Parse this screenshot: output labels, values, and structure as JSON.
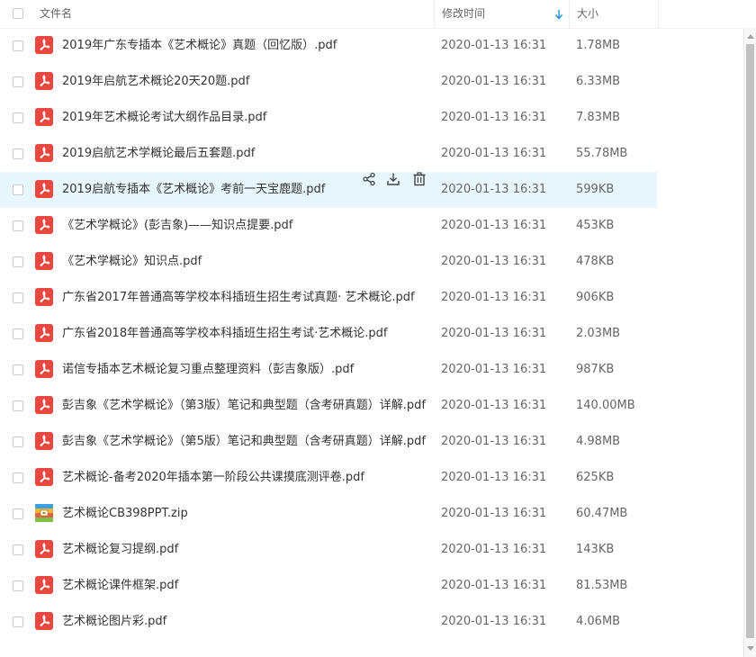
{
  "header": {
    "name_label": "文件名",
    "time_label": "修改时间",
    "size_label": "大小"
  },
  "colors": {
    "pdf_icon": "#e8483d",
    "highlight_row": "#e8f6fd",
    "sort_arrow": "#1e90e8"
  },
  "files": [
    {
      "name": "2019年广东专插本《艺术概论》真题（回忆版）.pdf",
      "time": "2020-01-13 16:31",
      "size": "1.78MB",
      "icon": "pdf-icon"
    },
    {
      "name": "2019年启航艺术概论20天20题.pdf",
      "time": "2020-01-13 16:31",
      "size": "6.33MB",
      "icon": "pdf-icon"
    },
    {
      "name": "2019年艺术概论考试大纲作品目录.pdf",
      "time": "2020-01-13 16:31",
      "size": "7.83MB",
      "icon": "pdf-icon"
    },
    {
      "name": "2019启航艺术学概论最后五套题.pdf",
      "time": "2020-01-13 16:31",
      "size": "55.78MB",
      "icon": "pdf-icon"
    },
    {
      "name": "2019启航专插本《艺术概论》考前一天宝鹿题.pdf",
      "time": "2020-01-13 16:31",
      "size": "599KB",
      "icon": "pdf-icon",
      "highlighted": true
    },
    {
      "name": "《艺术学概论》(彭吉象)——知识点提要.pdf",
      "time": "2020-01-13 16:31",
      "size": "453KB",
      "icon": "pdf-icon"
    },
    {
      "name": "《艺术学概论》知识点.pdf",
      "time": "2020-01-13 16:31",
      "size": "478KB",
      "icon": "pdf-icon"
    },
    {
      "name": "广东省2017年普通高等学校本科插班生招生考试真题· 艺术概论.pdf",
      "time": "2020-01-13 16:31",
      "size": "906KB",
      "icon": "pdf-icon"
    },
    {
      "name": "广东省2018年普通高等学校本科插班生招生考试·艺术概论.pdf",
      "time": "2020-01-13 16:31",
      "size": "2.03MB",
      "icon": "pdf-icon"
    },
    {
      "name": "诺信专插本艺术概论复习重点整理资料（彭吉象版）.pdf",
      "time": "2020-01-13 16:31",
      "size": "987KB",
      "icon": "pdf-icon"
    },
    {
      "name": "彭吉象《艺术学概论》（第3版）笔记和典型题（含考研真题）详解.pdf",
      "time": "2020-01-13 16:31",
      "size": "140.00MB",
      "icon": "pdf-icon"
    },
    {
      "name": "彭吉象《艺术学概论》（第5版）笔记和典型题（含考研真题）详解.pdf",
      "time": "2020-01-13 16:31",
      "size": "4.98MB",
      "icon": "pdf-icon"
    },
    {
      "name": "艺术概论-备考2020年插本第一阶段公共课摸底测评卷.pdf",
      "time": "2020-01-13 16:31",
      "size": "625KB",
      "icon": "pdf-icon"
    },
    {
      "name": "艺术概论CB398PPT.zip",
      "time": "2020-01-13 16:31",
      "size": "60.47MB",
      "icon": "zip-icon"
    },
    {
      "name": "艺术概论复习提纲.pdf",
      "time": "2020-01-13 16:31",
      "size": "143KB",
      "icon": "pdf-icon"
    },
    {
      "name": "艺术概论课件框架.pdf",
      "time": "2020-01-13 16:31",
      "size": "81.53MB",
      "icon": "pdf-icon"
    },
    {
      "name": "艺术概论图片彩.pdf",
      "time": "2020-01-13 16:31",
      "size": "4.06MB",
      "icon": "pdf-icon"
    }
  ]
}
